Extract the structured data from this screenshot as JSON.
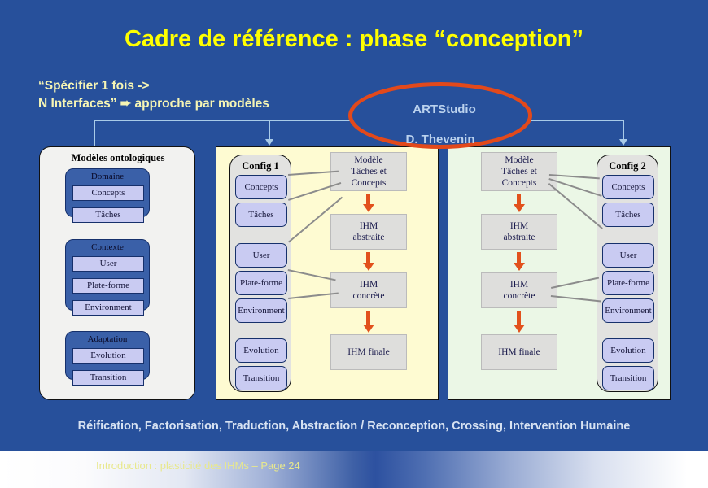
{
  "slide": {
    "title": "Cadre de référence : phase “conception”",
    "subtitle_line1": "“Spécifier 1 fois ->",
    "subtitle_line2_pre": "N Interfaces”",
    "subtitle_arrow": "➨",
    "subtitle_line2_post": "approche par modèles",
    "bottom_line": "Réification, Factorisation, Traduction, Abstraction / Reconception, Crossing, Intervention Humaine",
    "footer": "Introduction : plasticité des IHMs  – Page 24"
  },
  "ellipse": {
    "line1": "ARTStudio",
    "line2": "D. Thevenin"
  },
  "left_panel": {
    "title": "Modèles ontologiques",
    "groups": [
      {
        "title": "Domaine",
        "items": [
          "Concepts",
          "Tâches"
        ]
      },
      {
        "title": "Contexte",
        "items": [
          "User",
          "Plate-forme",
          "Environment"
        ]
      },
      {
        "title": "Adaptation",
        "items": [
          "Evolution",
          "Transition"
        ]
      }
    ]
  },
  "config1": {
    "title": "Config 1",
    "items": [
      "Concepts",
      "Tâches",
      "User",
      "Plate-forme",
      "Environment",
      "Evolution",
      "Transition"
    ]
  },
  "config2": {
    "title": "Config 2",
    "items": [
      "Concepts",
      "Tâches",
      "User",
      "Plate-forme",
      "Environment",
      "Evolution",
      "Transition"
    ]
  },
  "pipeline_mid": {
    "steps": [
      "Modèle\nTâches et\nConcepts",
      "IHM\nabstraite",
      "IHM\nconcrète",
      "IHM finale"
    ],
    "step1_l1": "Modèle",
    "step1_l2": "Tâches et",
    "step1_l3": "Concepts",
    "step2_l1": "IHM",
    "step2_l2": "abstraite",
    "step3_l1": "IHM",
    "step3_l2": "concrète",
    "step4_l1": "IHM finale"
  },
  "pipeline_right": {
    "step1_l1": "Modèle",
    "step1_l2": "Tâches et",
    "step1_l3": "Concepts",
    "step2_l1": "IHM",
    "step2_l2": "abstraite",
    "step3_l1": "IHM",
    "step3_l2": "concrète",
    "step4_l1": "IHM finale"
  },
  "colors": {
    "background": "#27509B",
    "title": "#FFFF00",
    "subtitle": "#F6F5B4",
    "ellipse_border": "#E2491B",
    "ellipse_text": "#BBD2EE",
    "panel_mid": "#FEFBD2",
    "panel_right": "#EBF7E6",
    "panel_left": "#F2F2F0",
    "group": "#3A60A8",
    "item": "#C9CBF2",
    "pipeline_box": "#DEDEDC",
    "arrow": "#E2511C",
    "connector": "#A9CBE8",
    "footer_text": "#E8E88C"
  }
}
